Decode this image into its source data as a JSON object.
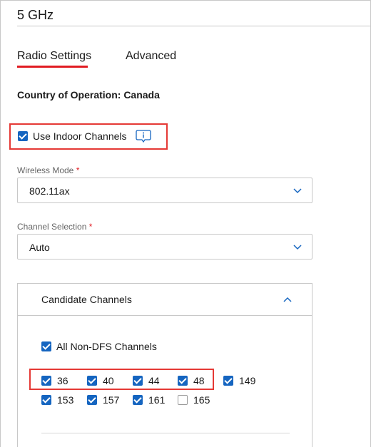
{
  "band": {
    "title": "5 GHz"
  },
  "tabs": [
    {
      "label": "Radio Settings",
      "active": true
    },
    {
      "label": "Advanced",
      "active": false
    }
  ],
  "country": {
    "text": "Country of Operation: Canada"
  },
  "indoor": {
    "label": "Use Indoor Channels",
    "checked": true,
    "icon": "info-icon"
  },
  "wireless_mode": {
    "label": "Wireless Mode",
    "required_mark": "*",
    "value": "802.11ax"
  },
  "channel_selection": {
    "label": "Channel Selection",
    "required_mark": "*",
    "value": "Auto"
  },
  "candidate": {
    "title": "Candidate Channels",
    "all_non_dfs": {
      "label": "All Non-DFS Channels",
      "checked": true
    },
    "channels": [
      {
        "label": "36",
        "checked": true
      },
      {
        "label": "40",
        "checked": true
      },
      {
        "label": "44",
        "checked": true
      },
      {
        "label": "48",
        "checked": true
      },
      {
        "label": "149",
        "checked": true
      },
      {
        "label": "153",
        "checked": true
      },
      {
        "label": "157",
        "checked": true
      },
      {
        "label": "161",
        "checked": true
      },
      {
        "label": "165",
        "checked": false
      }
    ]
  },
  "colors": {
    "accent": "#e11b22",
    "checkbox": "#1565c0",
    "highlight": "#e53935"
  }
}
